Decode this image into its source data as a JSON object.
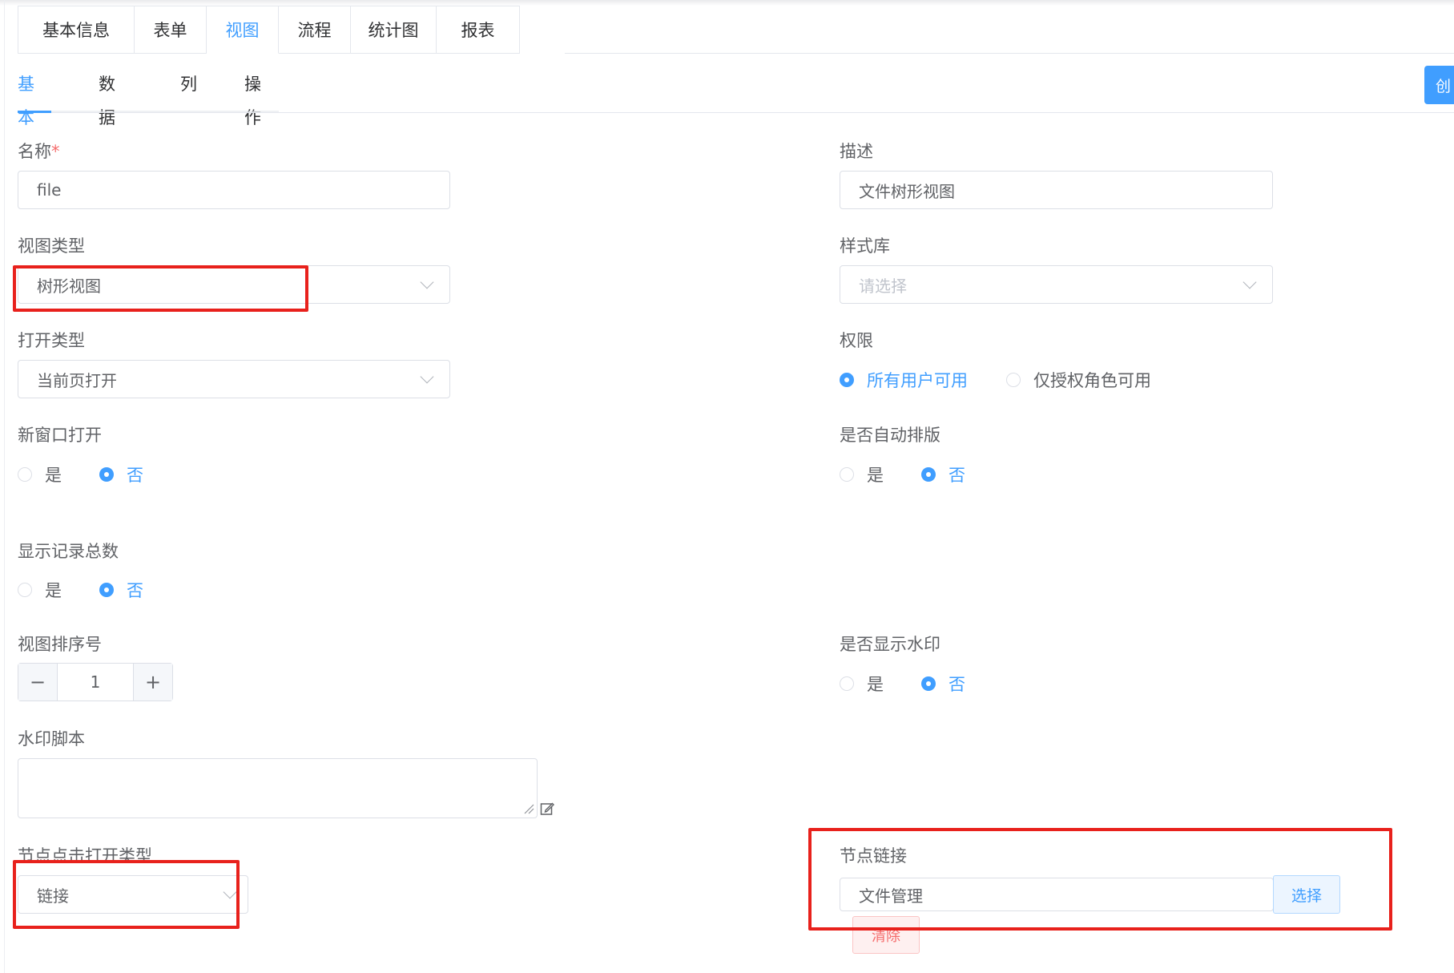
{
  "top_tabs": [
    "基本信息",
    "表单",
    "视图",
    "流程",
    "统计图",
    "报表"
  ],
  "sub_tabs": [
    "基本",
    "数据",
    "列",
    "操作"
  ],
  "corner_button_label": "创",
  "form": {
    "name": {
      "label": "名称",
      "required_mark": "*",
      "value": "file"
    },
    "description": {
      "label": "描述",
      "value": "文件树形视图"
    },
    "view_type": {
      "label": "视图类型",
      "value": "树形视图"
    },
    "style_lib": {
      "label": "样式库",
      "placeholder": "请选择"
    },
    "open_type": {
      "label": "打开类型",
      "value": "当前页打开"
    },
    "permission": {
      "label": "权限",
      "options": [
        "所有用户可用",
        "仅授权角色可用"
      ],
      "selected": "所有用户可用"
    },
    "new_window": {
      "label": "新窗口打开",
      "options": [
        "是",
        "否"
      ],
      "selected": "否"
    },
    "auto_layout": {
      "label": "是否自动排版",
      "options": [
        "是",
        "否"
      ],
      "selected": "否"
    },
    "show_total": {
      "label": "显示记录总数",
      "options": [
        "是",
        "否"
      ],
      "selected": "否"
    },
    "sort_no": {
      "label": "视图排序号",
      "value": "1",
      "minus": "−",
      "plus": "+"
    },
    "watermark_show": {
      "label": "是否显示水印",
      "options": [
        "是",
        "否"
      ],
      "selected": "否"
    },
    "watermark_script": {
      "label": "水印脚本",
      "value": ""
    },
    "node_click_type": {
      "label": "节点点击打开类型",
      "value": "链接"
    },
    "node_link": {
      "label": "节点链接",
      "value": "文件管理",
      "select_label": "选择",
      "clear_label": "清除"
    }
  },
  "colors": {
    "primary": "#409eff",
    "highlight": "#e8211c",
    "danger": "#f56c6c"
  }
}
